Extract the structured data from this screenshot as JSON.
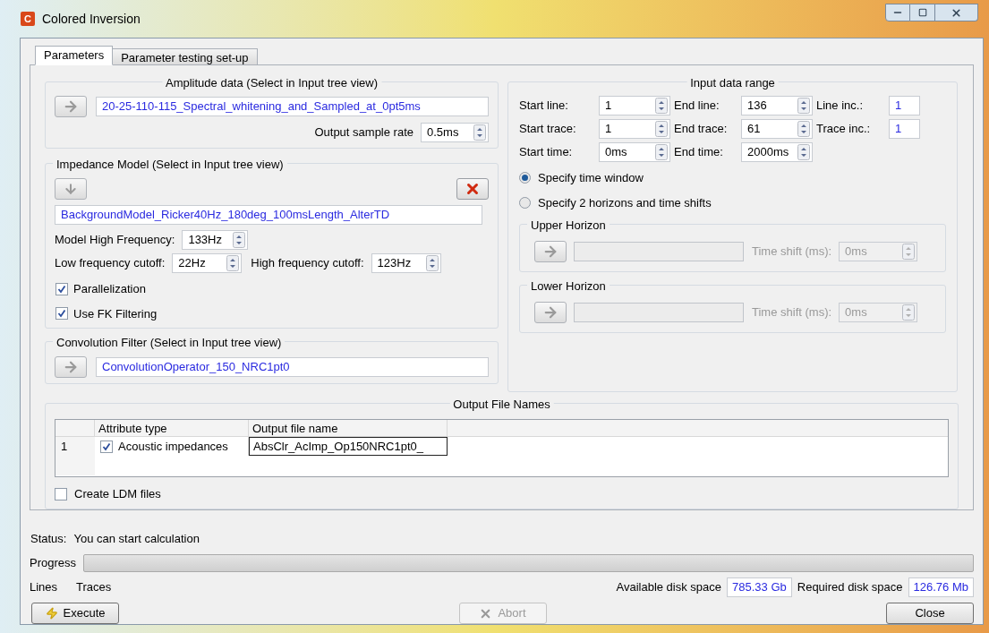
{
  "window": {
    "title": "Colored Inversion",
    "icon_letter": "C"
  },
  "tabs": [
    {
      "label": "Parameters",
      "selected": true
    },
    {
      "label": "Parameter testing set-up",
      "selected": false
    }
  ],
  "amplitude": {
    "title": "Amplitude data (Select in Input tree view)",
    "value": "20-25-110-115_Spectral_whitening_and_Sampled_at_0pt5ms",
    "sample_rate_label": "Output sample rate",
    "sample_rate": "0.5ms"
  },
  "impedance": {
    "title": "Impedance Model (Select in Input tree view)",
    "value": "BackgroundModel_Ricker40Hz_180deg_100msLength_AlterTD",
    "high_freq_label": "Model High Frequency:",
    "high_freq": "133Hz",
    "low_cut_label": "Low frequency cutoff:",
    "low_cut": "22Hz",
    "high_cut_label": "High frequency cutoff:",
    "high_cut": "123Hz",
    "checkboxes": [
      {
        "label": "Parallelization",
        "checked": true
      },
      {
        "label": "Use FK Filtering",
        "checked": true
      }
    ]
  },
  "convolution": {
    "title": "Convolution Filter (Select in Input tree view)",
    "value": "ConvolutionOperator_150_NRC1pt0"
  },
  "input_range": {
    "title": "Input data range",
    "rows": [
      [
        {
          "label": "Start line:",
          "value": "1",
          "kind": "spin"
        },
        {
          "label": "End line:",
          "value": "136",
          "kind": "spin"
        },
        {
          "label": "Line inc.:",
          "value": "1",
          "kind": "plain"
        }
      ],
      [
        {
          "label": "Start trace:",
          "value": "1",
          "kind": "spin"
        },
        {
          "label": "End trace:",
          "value": "61",
          "kind": "spin"
        },
        {
          "label": "Trace inc.:",
          "value": "1",
          "kind": "plain"
        }
      ],
      [
        {
          "label": "Start time:",
          "value": "0ms",
          "kind": "spin"
        },
        {
          "label": "End time:",
          "value": "2000ms",
          "kind": "spin"
        }
      ]
    ],
    "radios": [
      {
        "label": "Specify time window",
        "selected": true
      },
      {
        "label": "Specify 2 horizons and time shifts",
        "selected": false
      }
    ],
    "horizons": [
      {
        "title": "Upper Horizon",
        "shift_label": "Time shift (ms):",
        "shift": "0ms",
        "disabled": true
      },
      {
        "title": "Lower Horizon",
        "shift_label": "Time shift (ms):",
        "shift": "0ms",
        "disabled": true
      }
    ]
  },
  "output": {
    "title": "Output File Names",
    "columns": [
      "Attribute type",
      "Output file name"
    ],
    "rows": [
      {
        "index": "1",
        "checked": true,
        "attribute": "Acoustic impedances",
        "file": "AbsClr_AcImp_Op150NRC1pt0_"
      }
    ],
    "ldm": {
      "label": "Create LDM files",
      "checked": false
    }
  },
  "status": {
    "label": "Status:",
    "text": "You can start calculation"
  },
  "progress": {
    "label": "Progress",
    "level": 0
  },
  "counters": [
    "Lines",
    "Traces"
  ],
  "disk": [
    {
      "label": "Available disk space",
      "value": "785.33 Gb"
    },
    {
      "label": "Required disk space",
      "value": "126.76 Mb"
    }
  ],
  "buttons": [
    {
      "label": "Execute",
      "kind": "execute",
      "disabled": false
    },
    {
      "label": "Abort",
      "kind": "abort",
      "disabled": true
    },
    {
      "label": "Close",
      "kind": "close",
      "disabled": false
    }
  ]
}
